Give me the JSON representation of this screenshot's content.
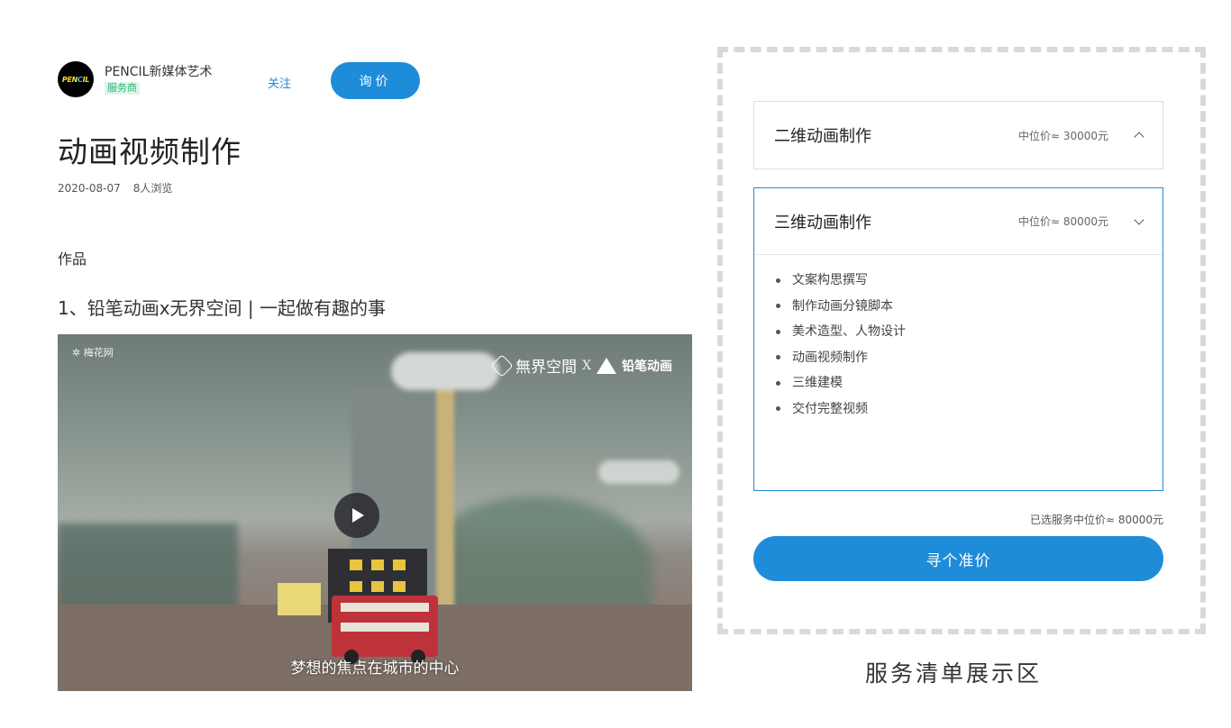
{
  "author": {
    "name": "PENCIL新媒体艺术",
    "badge": "服务商",
    "avatar_text": "PENCIL",
    "follow_label": "关注",
    "inquire_label": "询价"
  },
  "post": {
    "title": "动画视频制作",
    "date": "2020-08-07",
    "views": "8人浏览"
  },
  "works": {
    "section_label": "作品",
    "item_title": "1、铅笔动画x无界空间 | 一起做有趣的事",
    "video": {
      "logo_left": "梅花网",
      "logo_right_brand": "無界空間",
      "logo_right_sep": "X",
      "logo_right_partner": "铅笔动画",
      "subtitle": "梦想的焦点在城市的中心"
    }
  },
  "services": {
    "items": [
      {
        "name": "二维动画制作",
        "price": "中位价≈ 30000元",
        "expanded": false
      },
      {
        "name": "三维动画制作",
        "price": "中位价≈ 80000元",
        "expanded": true,
        "features": [
          "文案构思撰写",
          "制作动画分镜脚本",
          "美术造型、人物设计",
          "动画视频制作",
          "三维建模",
          "交付完整视频"
        ]
      }
    ],
    "summary": "已选服务中位价≈ 80000元",
    "quote_label": "寻个准价",
    "caption": "服务清单展示区"
  },
  "colors": {
    "accent": "#1e8cd9",
    "badge_bg": "#dff5ee",
    "badge_text": "#2bb673"
  }
}
